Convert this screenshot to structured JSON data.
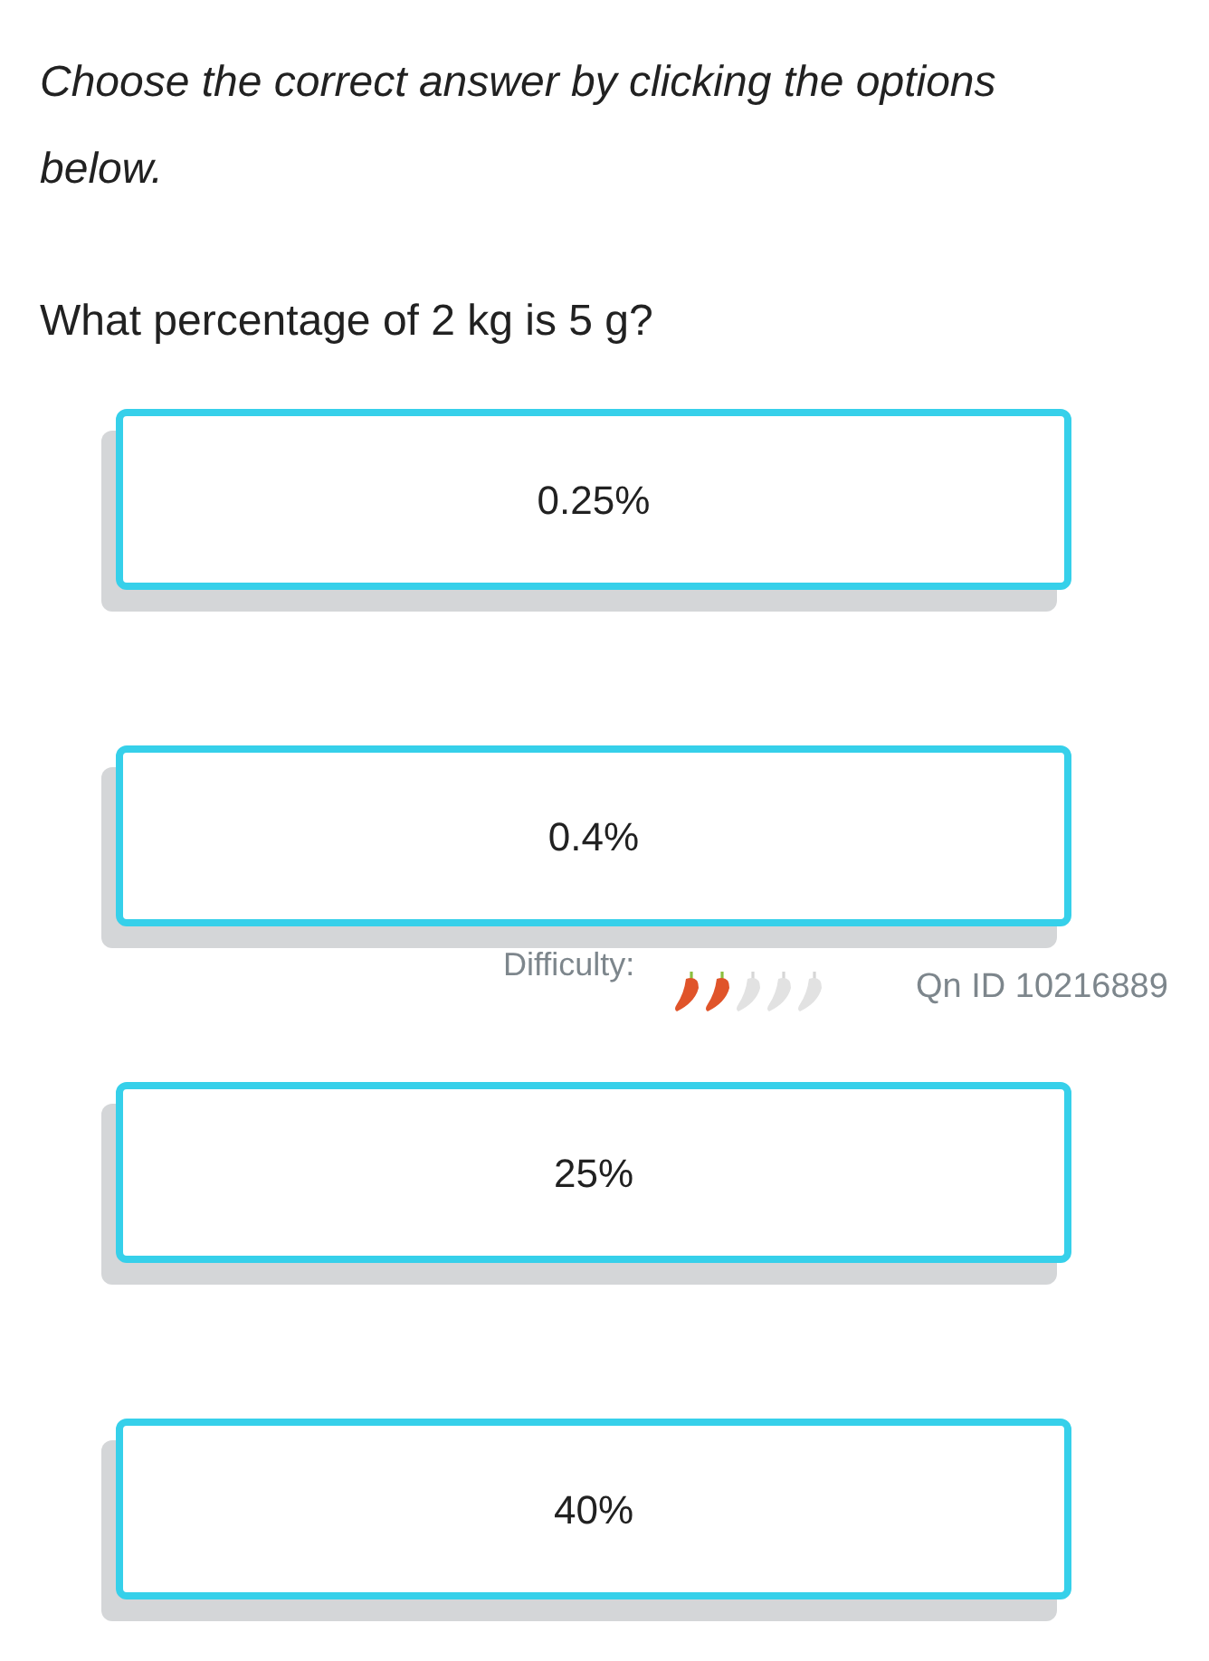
{
  "instruction": "Choose the correct answer by clicking the options below.",
  "question": "What percentage of 2 kg is 5 g?",
  "options": [
    {
      "label": "0.25%"
    },
    {
      "label": "0.4%"
    },
    {
      "label": "25%"
    },
    {
      "label": "40%"
    }
  ],
  "difficulty": {
    "label": "Difficulty:",
    "stars": 2
  },
  "question_id": "Qn ID 10216889"
}
